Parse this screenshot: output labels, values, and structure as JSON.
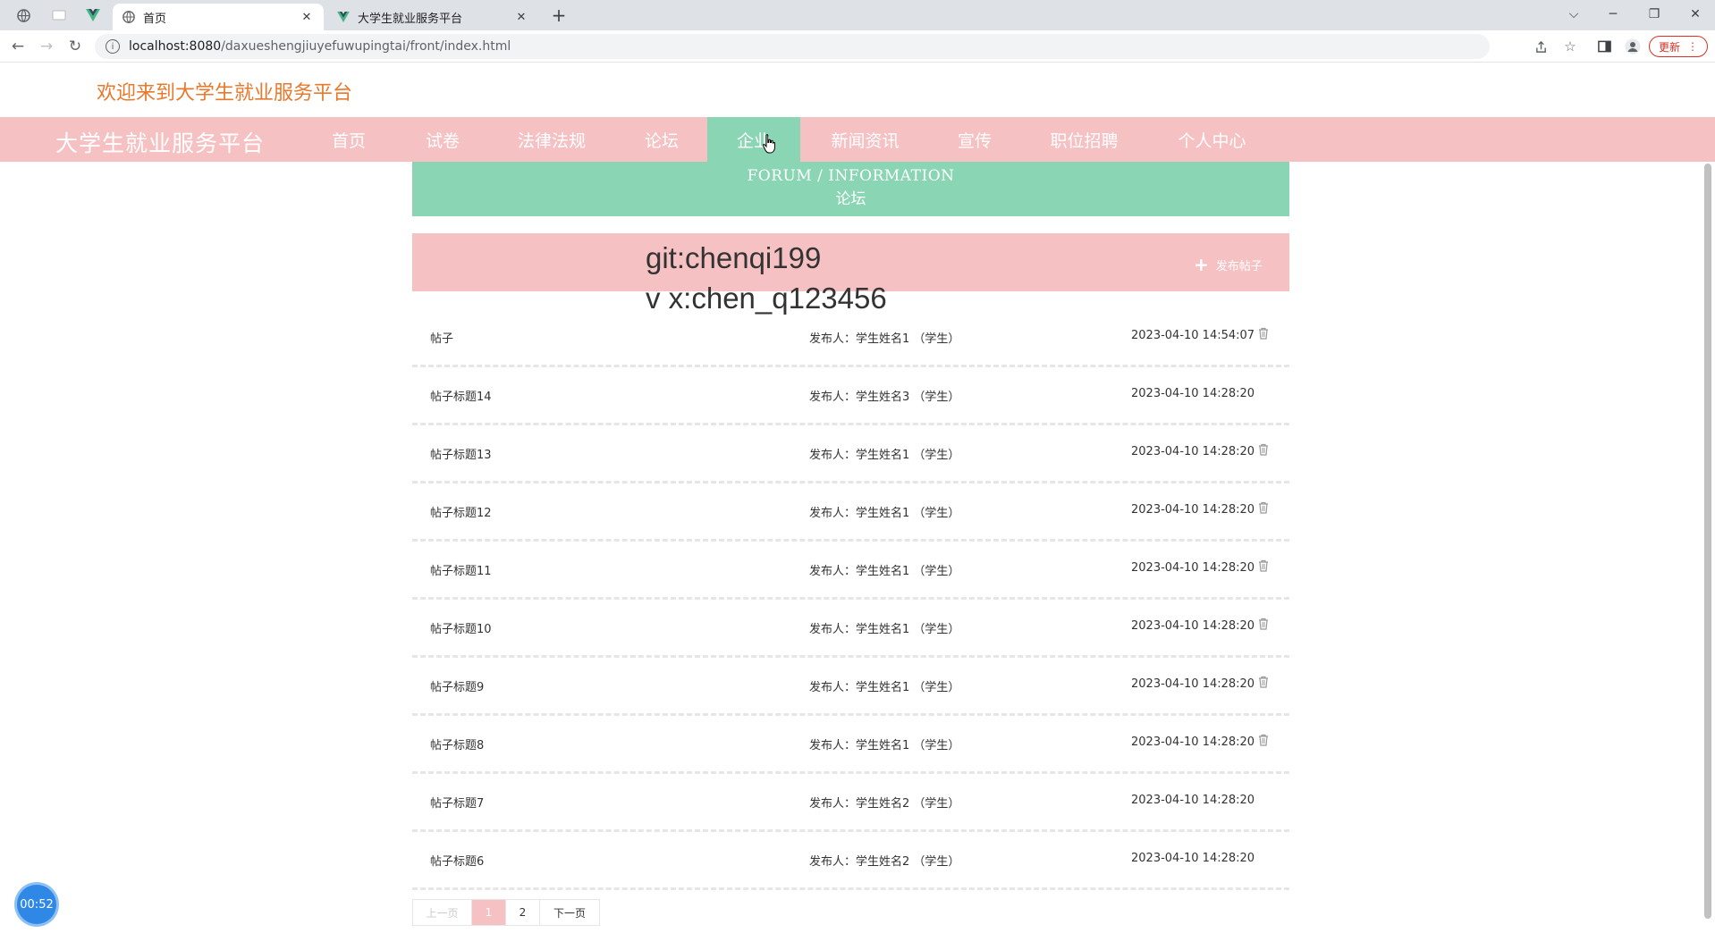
{
  "browser": {
    "tabs": [
      {
        "title": "首页",
        "icon": "globe-icon",
        "active": true
      },
      {
        "title": "大学生就业服务平台",
        "icon": "vue-logo-icon",
        "active": false
      }
    ],
    "url_host": "localhost:8080",
    "url_path": "/daxueshengjiuyefuwupingtai/front/index.html",
    "update_label": "更新"
  },
  "page": {
    "welcome": "欢迎来到大学生就业服务平台",
    "brand": "大学生就业服务平台",
    "nav": [
      {
        "label": "首页",
        "active": false
      },
      {
        "label": "试卷",
        "active": false
      },
      {
        "label": "法律法规",
        "active": false
      },
      {
        "label": "论坛",
        "active": false
      },
      {
        "label": "企业",
        "active": true
      },
      {
        "label": "新闻资讯",
        "active": false
      },
      {
        "label": "宣传",
        "active": false
      },
      {
        "label": "职位招聘",
        "active": false
      },
      {
        "label": "个人中心",
        "active": false
      }
    ],
    "banner_en": "FORUM / INFORMATION",
    "banner_cn": "论坛",
    "publish_label": "发布帖子",
    "watermark_line1": "git:chenqi199",
    "watermark_line2": "v x:chen_q123456",
    "posts": [
      {
        "title": "帖子",
        "author": "发布人：学生姓名1 （学生）",
        "time": "2023-04-10 14:54:07",
        "deletable": true
      },
      {
        "title": "帖子标题14",
        "author": "发布人：学生姓名3 （学生）",
        "time": "2023-04-10 14:28:20",
        "deletable": false
      },
      {
        "title": "帖子标题13",
        "author": "发布人：学生姓名1 （学生）",
        "time": "2023-04-10 14:28:20",
        "deletable": true
      },
      {
        "title": "帖子标题12",
        "author": "发布人：学生姓名1 （学生）",
        "time": "2023-04-10 14:28:20",
        "deletable": true
      },
      {
        "title": "帖子标题11",
        "author": "发布人：学生姓名1 （学生）",
        "time": "2023-04-10 14:28:20",
        "deletable": true
      },
      {
        "title": "帖子标题10",
        "author": "发布人：学生姓名1 （学生）",
        "time": "2023-04-10 14:28:20",
        "deletable": true
      },
      {
        "title": "帖子标题9",
        "author": "发布人：学生姓名1 （学生）",
        "time": "2023-04-10 14:28:20",
        "deletable": true
      },
      {
        "title": "帖子标题8",
        "author": "发布人：学生姓名1 （学生）",
        "time": "2023-04-10 14:28:20",
        "deletable": true
      },
      {
        "title": "帖子标题7",
        "author": "发布人：学生姓名2 （学生）",
        "time": "2023-04-10 14:28:20",
        "deletable": false
      },
      {
        "title": "帖子标题6",
        "author": "发布人：学生姓名2 （学生）",
        "time": "2023-04-10 14:28:20",
        "deletable": false
      }
    ],
    "pager": {
      "prev": "上一页",
      "pages": [
        "1",
        "2"
      ],
      "current": "1",
      "next": "下一页"
    },
    "timer": "00:52"
  },
  "colors": {
    "pink": "#f6c1c3",
    "green": "#8ad6b4",
    "orange": "#e8782b"
  }
}
